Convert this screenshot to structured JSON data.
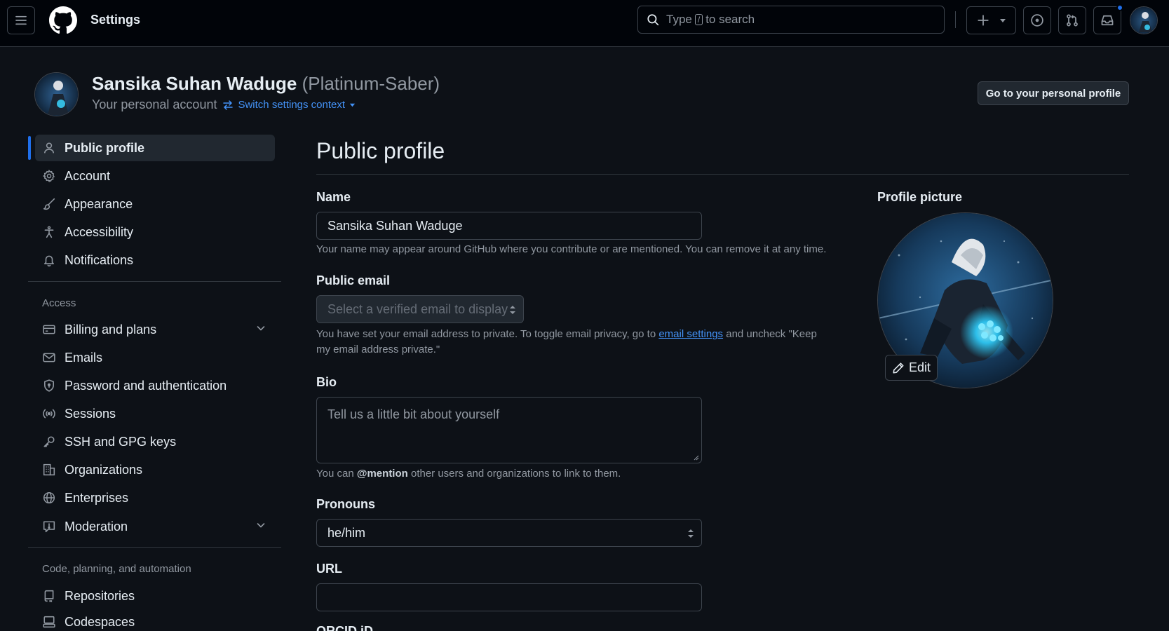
{
  "header": {
    "title": "Settings",
    "search_prefix": "Type",
    "search_key": "/",
    "search_suffix": "to search"
  },
  "context": {
    "name": "Sansika Suhan Waduge",
    "login": "(Platinum-Saber)",
    "subtitle": "Your personal account",
    "switch_label": "Switch settings context",
    "profile_button": "Go to your personal profile"
  },
  "sidebar": {
    "items": [
      {
        "label": "Public profile",
        "icon": "person-icon",
        "active": true
      },
      {
        "label": "Account",
        "icon": "gear-icon"
      },
      {
        "label": "Appearance",
        "icon": "paintbrush-icon"
      },
      {
        "label": "Accessibility",
        "icon": "accessibility-icon"
      },
      {
        "label": "Notifications",
        "icon": "bell-icon"
      }
    ],
    "access_heading": "Access",
    "access_items": [
      {
        "label": "Billing and plans",
        "icon": "credit-card-icon",
        "expandable": true
      },
      {
        "label": "Emails",
        "icon": "mail-icon"
      },
      {
        "label": "Password and authentication",
        "icon": "shield-icon"
      },
      {
        "label": "Sessions",
        "icon": "broadcast-icon"
      },
      {
        "label": "SSH and GPG keys",
        "icon": "key-icon"
      },
      {
        "label": "Organizations",
        "icon": "organization-icon"
      },
      {
        "label": "Enterprises",
        "icon": "globe-icon"
      },
      {
        "label": "Moderation",
        "icon": "report-icon",
        "expandable": true
      }
    ],
    "code_heading": "Code, planning, and automation",
    "code_items": [
      {
        "label": "Repositories",
        "icon": "repo-icon"
      },
      {
        "label": "Codespaces",
        "icon": "codespaces-icon"
      }
    ]
  },
  "main": {
    "title": "Public profile",
    "name_label": "Name",
    "name_value": "Sansika Suhan Waduge",
    "name_help": "Your name may appear around GitHub where you contribute or are mentioned. You can remove it at any time.",
    "email_label": "Public email",
    "email_placeholder": "Select a verified email to display",
    "email_help_before": "You have set your email address to private. To toggle email privacy, go to",
    "email_help_link": "email settings",
    "email_help_after": "and uncheck \"Keep my email address private.\"",
    "bio_label": "Bio",
    "bio_placeholder": "Tell us a little bit about yourself",
    "bio_help_before": "You can",
    "bio_help_mention": "@mention",
    "bio_help_after": "other users and organizations to link to them.",
    "pronouns_label": "Pronouns",
    "pronouns_value": "he/him",
    "url_label": "URL",
    "url_value": "",
    "orcid_label": "ORCID iD",
    "picture_label": "Profile picture",
    "edit_label": "Edit"
  },
  "colors": {
    "accent": "#4493f8",
    "active_bar": "#1f6feb",
    "notification_dot": "#1f6feb",
    "background": "#0d1117",
    "header_background": "#010409"
  }
}
